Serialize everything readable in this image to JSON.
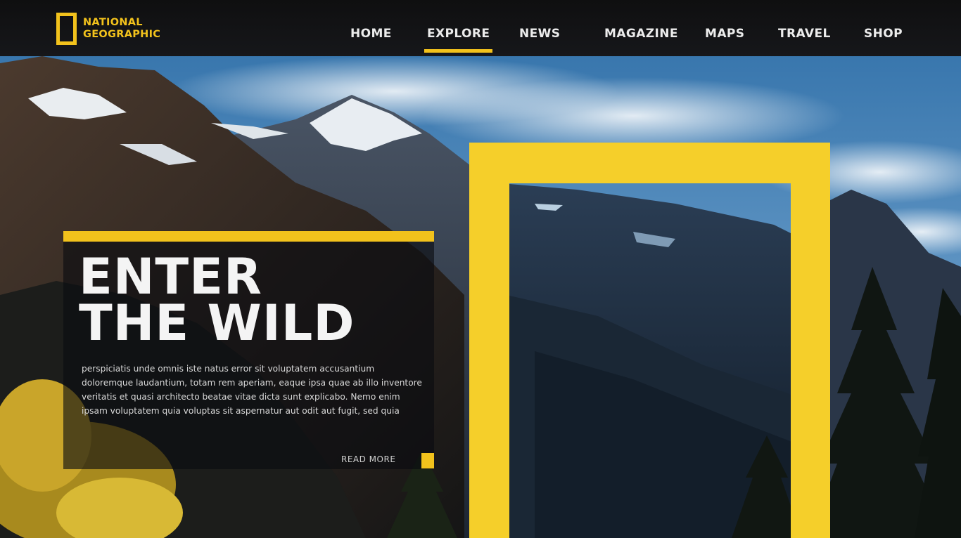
{
  "brand": {
    "logo_icon": "yellow-rectangle-frame-icon",
    "logo_line1": "NATIONAL",
    "logo_line2": "GEOGRAPHIC",
    "accent_color": "#f2c21c"
  },
  "nav": {
    "active": "EXPLORE",
    "items": [
      "HOME",
      "EXPLORE",
      "NEWS",
      "MAGAZINE",
      "MAPS",
      "TRAVEL",
      "SHOP"
    ]
  },
  "hero": {
    "title_line1": "ENTER",
    "title_line2": "THE WILD",
    "body": "perspiciatis unde omnis iste natus error sit voluptatem accusantium doloremque laudantium, totam rem aperiam, eaque ipsa quae ab illo inventore veritatis et quasi architecto beatae vitae dicta sunt explicabo. Nemo enim ipsam voluptatem quia voluptas sit aspernatur aut odit aut fugit, sed quia",
    "read_more": "READ MORE"
  }
}
